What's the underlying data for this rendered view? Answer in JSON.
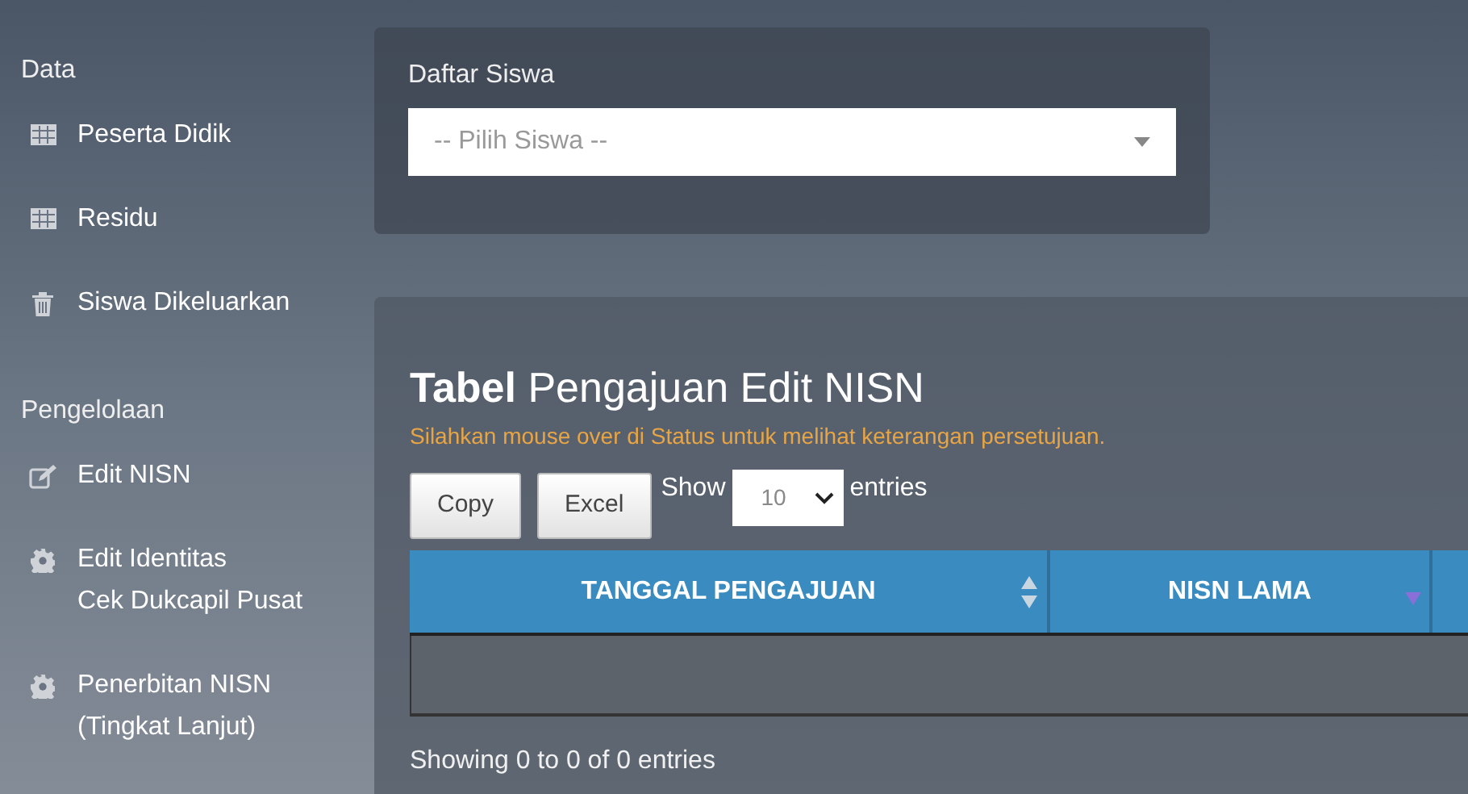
{
  "sidebar": {
    "sections": [
      {
        "heading": "Data",
        "items": [
          {
            "label": "Peserta Didik",
            "kind": "table"
          },
          {
            "label": "Residu",
            "kind": "table"
          },
          {
            "label": "Siswa Dikeluarkan",
            "kind": "trash"
          }
        ]
      },
      {
        "heading": "Pengelolaan",
        "items": [
          {
            "label": "Edit NISN",
            "kind": "edit"
          },
          {
            "label": "Edit Identitas\nCek Dukcapil Pusat",
            "kind": "gear"
          },
          {
            "label": "Penerbitan NISN\n(Tingkat Lanjut)",
            "kind": "gear"
          }
        ]
      }
    ]
  },
  "student_panel": {
    "label": "Daftar Siswa",
    "select": {
      "placeholder": "-- Pilih Siswa --"
    }
  },
  "table_panel": {
    "title": "**Tabel** Pengajuan Edit NISN",
    "hint": "Silahkan mouse over di Status untuk melihat keterangan persetujuan.",
    "buttons": [
      "Copy",
      "Excel"
    ],
    "length": {
      "before": "Show",
      "value": "10",
      "after": "entries"
    },
    "columns": [
      {
        "label": "TANGGAL PENGAJUAN",
        "sorted": false
      },
      {
        "label": "NISN LAMA",
        "sorted": true
      }
    ],
    "info": "Showing 0 to 0 of 0 entries"
  }
}
